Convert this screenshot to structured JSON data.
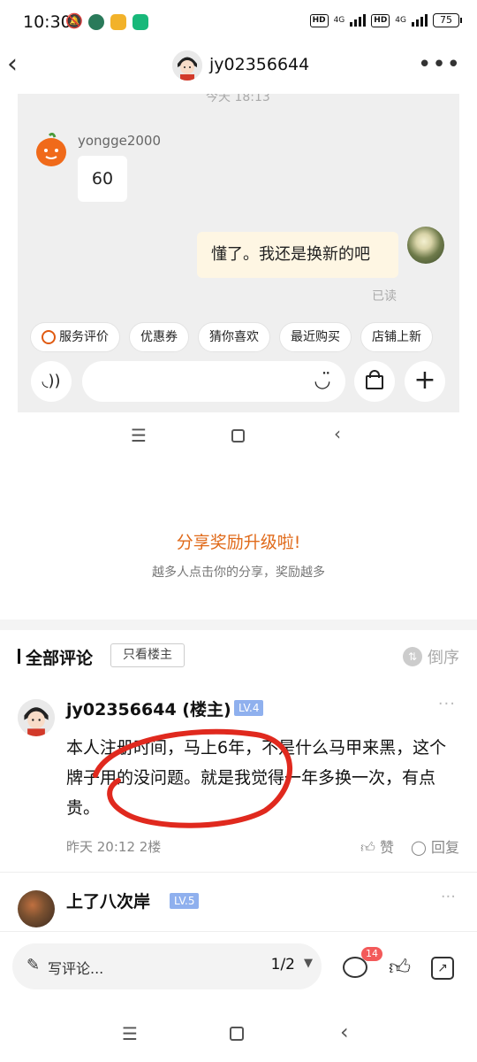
{
  "status_bar": {
    "time": "10:30",
    "net1": "4G",
    "net2": "4G",
    "hd": "HD",
    "battery": "75"
  },
  "header": {
    "username": "jy02356644"
  },
  "chat_screenshot": {
    "timestamp": "今天  18:13",
    "sender_name": "yongge2000",
    "left_message": "60",
    "right_message": "懂了。我还是换新的吧",
    "read_status": "已读",
    "quick_chips": [
      "服务评价",
      "优惠券",
      "猜你喜欢",
      "最近购买",
      "店铺上新"
    ]
  },
  "share": {
    "title": "分享奖励升级啦!",
    "subtitle": "越多人点击你的分享，奖励越多"
  },
  "comments_header": {
    "title": "全部评论",
    "filter": "只看楼主",
    "sort": "倒序"
  },
  "comments": [
    {
      "name": "jy02356644 (楼主)",
      "level": "LV.4",
      "text": "本人注册时间，马上6年，不是什么马甲来黑，这个牌子用的没问题。就是我觉得一年多换一次，有点贵。",
      "meta": "昨天 20:12  2楼",
      "like": "赞",
      "reply": "回复"
    },
    {
      "name": "上了八次岸",
      "level": "LV.5"
    }
  ],
  "bottom_bar": {
    "write_label": "写评论...",
    "page_indicator": "1/2",
    "comment_badge": "14"
  },
  "colors": {
    "accent_orange": "#e06a1a",
    "level_badge": "#8fb0ee",
    "red_annotation": "#e0291e",
    "badge_red": "#f35a5a"
  }
}
